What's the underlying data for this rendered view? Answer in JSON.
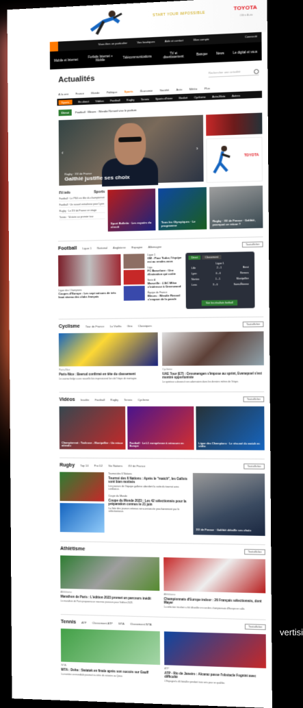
{
  "banner": {
    "slogan": "START YOUR IMPOSSIBLE",
    "brand": "TOYOTA",
    "brand_sub": "Offre Auto"
  },
  "topbar": {
    "items": [
      "Vous êtes un particulier",
      "Vos boutiques",
      "Aide et contact",
      "Mon compte"
    ],
    "user": "Connecté"
  },
  "menu": [
    "Mobile et Internet",
    "Forfaits Internet + Mobile",
    "Télécommunications",
    "TV et divertissement",
    "Banque",
    "News",
    "Le digital et vous"
  ],
  "page": {
    "title": "Actualités",
    "search_placeholder": "Rechercher une actualité"
  },
  "subnav": [
    "À la une",
    "France",
    "Monde",
    "Politique",
    "Sports",
    "Économie",
    "Société",
    "Auto",
    "Météo",
    "Plus"
  ],
  "subnav_active": "Sports",
  "subnav2": [
    "Sports",
    "En direct",
    "Vidéos",
    "Football",
    "Rugby",
    "Tennis",
    "Sports d'hiver",
    "Basket",
    "Cyclisme",
    "Auto-Moto",
    "Autres"
  ],
  "direct": {
    "tag": "Direct",
    "text": "Football · Bleues : Wendie Renard vise le podium"
  },
  "hero": {
    "caption": "Rugby · XV de France",
    "title": "Galthié justifie ses choix"
  },
  "side_ad": {
    "brand": "TOYOTA"
  },
  "flash": {
    "heading": "Fil info",
    "sports_label": "Sports",
    "items": [
      "Football · Le PSG en tête du championnat",
      "Football · Un nouvel entraîneur pour Lyon",
      "Rugby · Le XV de France en stage",
      "Tennis · Victoire au premier tour"
    ]
  },
  "tiles": [
    {
      "title": "Sport Bulletin · Les espoirs du circuit"
    },
    {
      "title": "Tous les Olympiques · Le programme"
    },
    {
      "title": "Rugby · XV de France · Galthié, pourquoi ce retour ?"
    }
  ],
  "football": {
    "name": "Football",
    "links": [
      "Ligue 1",
      "National",
      "Angleterre",
      "Espagne",
      "Allemagne"
    ],
    "all": "Tout afficher",
    "news": [
      {
        "cap": "Ligue 1",
        "title": "OM : Pour Tudor, l'équipe est au rendez-vous"
      },
      {
        "cap": "Liga",
        "title": "FC Barcelone : Une élimination qui coûte"
      },
      {
        "cap": "Serie A",
        "title": "Marseille : L'AC Milan s'intéresse à Greenwood"
      },
      {
        "cap": "Équipe de France",
        "title": "Bleues : Wendie Renard s'empare de la parole"
      }
    ],
    "bottom_cap": "Ligue des Champions",
    "bottom_title": "Coupes d'Europe : Les sept saisons de très haut niveau des clubs français",
    "matches": {
      "tabs": [
        "Direct",
        "Classement"
      ],
      "league": "Ligue 1",
      "rows": [
        {
          "home": "Lille",
          "score": "2 - 1",
          "away": "Brest"
        },
        {
          "home": "Lyon",
          "score": "0 - 0",
          "away": "Rennes"
        },
        {
          "home": "Nantes",
          "score": "1 - 1",
          "away": "Montpellier"
        },
        {
          "home": "Lens",
          "score": "3 - 0",
          "away": "Saint-Étienne"
        }
      ],
      "button": "Voir les résultats football"
    }
  },
  "cyclisme": {
    "name": "Cyclisme",
    "links": [
      "Tour de France",
      "La Vuelta",
      "Giro",
      "Classiques"
    ],
    "all": "Tout afficher",
    "articles": [
      {
        "cap": "Paris-Nice",
        "title": "Paris-Nice : Beerud confirmé en tête du classement",
        "text": "Le coureur belge a une nouvelle fois impressionné lors de l'étape de montagne."
      },
      {
        "cap": "Cyclisme",
        "title": "UAE Tour (E7) : Grosmengen s'impose au sprint, Evenepoel s'est montré opportuniste",
        "text": "Le sprinteur a devancé ses adversaires dans les derniers mètres de l'étape."
      }
    ]
  },
  "videos": {
    "name": "Vidéos",
    "links": [
      "Insolite",
      "Football",
      "Rugby",
      "Tennis",
      "Cyclisme"
    ],
    "all": "Tout afficher",
    "items": [
      {
        "title": "Championnat : Toulouse - Montpellier : Un retour attendu"
      },
      {
        "title": "Football · La L1 européenne à retrouver en Europe"
      },
      {
        "title": "Ligue des Champions · Le résumé du match en vidéo"
      }
    ]
  },
  "rugby": {
    "name": "Rugby",
    "links": [
      "Top 14",
      "Pro D2",
      "Six Nations",
      "XV de France"
    ],
    "all": "Tout afficher",
    "articles": [
      {
        "cap": "Tournoi des 6 Nations",
        "title": "Tournoi des 6 Nations : Après le \"match\", les Gallois sont bien motivés",
        "text": "Les joueurs de l'équipe galloise abordent la suite du tournoi avec confiance."
      },
      {
        "cap": "Coupe du Monde",
        "title": "Coupe du Monde 2023 : Les 42 sélectionnés pour la préparation connus le 21 juin",
        "text": "La liste des joueurs retenus sera annoncée prochainement par le sélectionneur."
      }
    ],
    "big": "XV de France · Galthié détaille ses choix"
  },
  "athletisme": {
    "name": "Athlétisme",
    "all": "Tout afficher",
    "articles": [
      {
        "cap": "Athlétisme",
        "title": "Marathon de Paris : L'édition 2023 promet un parcours inédit",
        "text": "Le marathon de Paris proposera un nouveau parcours pour l'édition 2023."
      },
      {
        "cap": "Athlétisme",
        "title": "Championnats d'Europe indoor : 26 Français sélectionnés, dont Mayer",
        "text": "La sélection tricolore a été dévoilée en vue des championnats d'Europe en salle."
      }
    ]
  },
  "tennis": {
    "name": "Tennis",
    "links": [
      "ATP",
      "Classement ATP",
      "WTA",
      "Classement WTA"
    ],
    "all": "Tout afficher",
    "articles": [
      {
        "cap": "WTA",
        "title": "WTA : Doha : Swiatek en finale après son succès sur Gauff",
        "text": "La numéro un mondiale poursuit sa série de victoires au Qatar."
      },
      {
        "cap": "ATP",
        "title": "ATP · Rio de Janeiro : Alcaraz passe l'obstacle Fognini avec difficulté",
        "text": "L'Espagnol a dû batailler pendant trois sets pour se qualifier."
      }
    ]
  },
  "overflow_text": "vertisi"
}
